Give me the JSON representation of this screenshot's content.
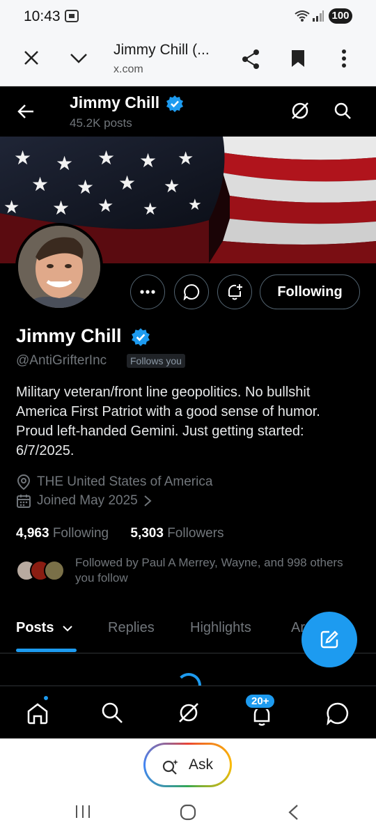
{
  "status_bar": {
    "time": "10:43",
    "battery": "100"
  },
  "browser": {
    "page_title": "Jimmy Chill (...",
    "url": "x.com"
  },
  "profile": {
    "display_name": "Jimmy Chill",
    "posts_count": "45.2K posts",
    "handle": "@AntiGrifterInc",
    "follows_you": "Follows you",
    "following_button": "Following",
    "bio": "Military veteran/front line geopolitics. No bullshit America First Patriot with a good sense of humor. Proud left-handed Gemini. Just getting started: 6/7/2025.",
    "location": "THE United States of America",
    "joined": "Joined May 2025",
    "following_count": "4,963",
    "following_label": "Following",
    "followers_count": "5,303",
    "followers_label": "Followers",
    "followed_by": "Followed by Paul A Merrey, Wayne, and 998 others you follow"
  },
  "tabs": [
    {
      "label": "Posts"
    },
    {
      "label": "Replies"
    },
    {
      "label": "Highlights"
    },
    {
      "label": "Ar"
    }
  ],
  "bottom_nav": {
    "notification_badge": "20+"
  },
  "ask": {
    "label": "Ask"
  },
  "colors": {
    "accent": "#1d9bf0",
    "background": "#000000",
    "muted": "#71767b"
  }
}
